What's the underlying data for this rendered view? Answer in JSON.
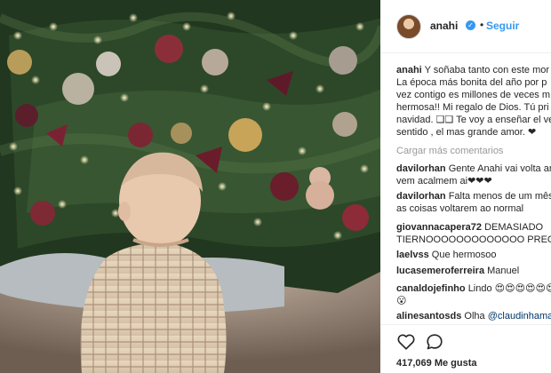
{
  "post": {
    "username": "anahi",
    "follow_label": "Seguir",
    "dot": "•"
  },
  "caption": {
    "username": "anahi",
    "lines": [
      "Y soñaba tanto con este mor",
      "La época más bonita del año por p",
      "vez contigo es millones de veces m",
      "hermosa!! Mi regalo de Dios. Tú pri",
      "navidad. ❑❑ Te voy a enseñar el ve",
      "sentido , el mas grande amor. ❤"
    ]
  },
  "load_more_label": "Cargar más comentarios",
  "comments": [
    {
      "username": "davilorhan",
      "lines": [
        "Gente Anahi vai volta an",
        "vem acalmem ai❤❤❤"
      ]
    },
    {
      "username": "davilorhan",
      "lines": [
        "Falta menos de um mês",
        "as coisas voltarem ao normal"
      ]
    },
    {
      "username": "giovannacapera72",
      "lines": [
        "DEMASIADO",
        "TIERNOOOOOOOOOOOOO PRECI"
      ]
    },
    {
      "username": "laelvss",
      "lines": [
        "Que hermosoo"
      ]
    },
    {
      "username": "lucasemeroferreira",
      "lines": [
        "Manuel"
      ]
    },
    {
      "username": "canaldojefinho",
      "lines": [
        "Lindo 😍😍😍😍😍😍",
        "😮"
      ]
    },
    {
      "username": "alinesantosds",
      "lines": [
        "Olha "
      ],
      "mention": "@claudinhama"
    }
  ],
  "likes_label": "417,069 Me gusta",
  "colors": {
    "link_blue": "#3897f0",
    "mention_blue": "#003569",
    "muted_gray": "#999999",
    "text": "#262626"
  },
  "icons": [
    "heart-icon",
    "comment-icon",
    "verified-badge-icon"
  ]
}
